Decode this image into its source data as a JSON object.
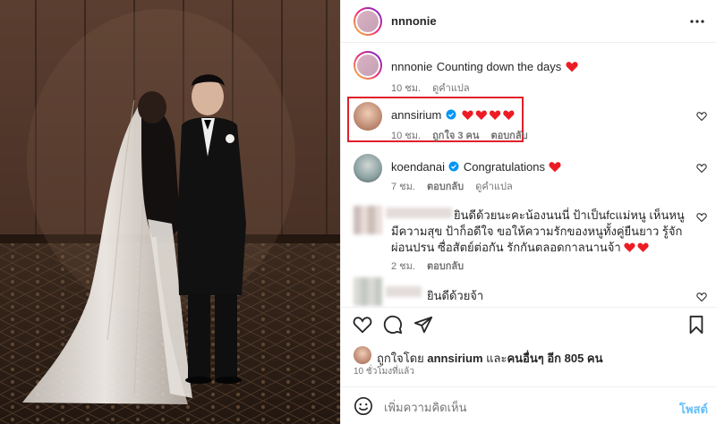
{
  "header": {
    "username": "nnnonie",
    "more_icon": "more-horizontal-icon"
  },
  "comments": [
    {
      "username": "nnnonie",
      "text": "Counting down the days",
      "emoji": "❤️",
      "time": "10 ชม.",
      "translate": "ดูคำแปล"
    },
    {
      "username": "annsirium",
      "verified": true,
      "text": "",
      "emoji": "❤️❤️❤️❤️",
      "time": "10 ชม.",
      "likes": "ถูกใจ 3 คน",
      "reply": "ตอบกลับ"
    },
    {
      "username": "koendanai",
      "verified": true,
      "text": "Congratulations",
      "emoji": "❤️",
      "time": "7 ชม.",
      "reply": "ตอบกลับ",
      "translate": "ดูคำแปล"
    },
    {
      "username": "",
      "text": "ยินดีด้วยนะคะน้องนนนี่ ป้าเป็นfcแม่หนู เห็นหนูมีความสุข ป้าก็อดีใจ ขอให้ความรักของหนูทั้งคู่ยืนยาว รู้จักผ่อนปรน ซื่อสัตย์ต่อกัน รักกันตลอดกาลนานจ้า",
      "emoji": "❤️❤️",
      "time": "2 ชม.",
      "reply": "ตอบกลับ"
    },
    {
      "username": "",
      "text": "ยินดีด้วยจ้า",
      "emoji": "",
      "time": "",
      "reply": ""
    }
  ],
  "likes": {
    "prefix": "ถูกใจโดย",
    "user": "annsirium",
    "middle": "และ",
    "rest": "คนอื่นๆ อีก 805 คน"
  },
  "posted_time": "10 ชั่วโมงที่แล้ว",
  "comment_box": {
    "placeholder": "เพิ่มความคิดเห็น",
    "post_label": "โพสต์"
  },
  "colors": {
    "heart": "#ed1c24",
    "verified": "#0095f6",
    "link": "#0095f6",
    "highlight": "#e0202a"
  }
}
